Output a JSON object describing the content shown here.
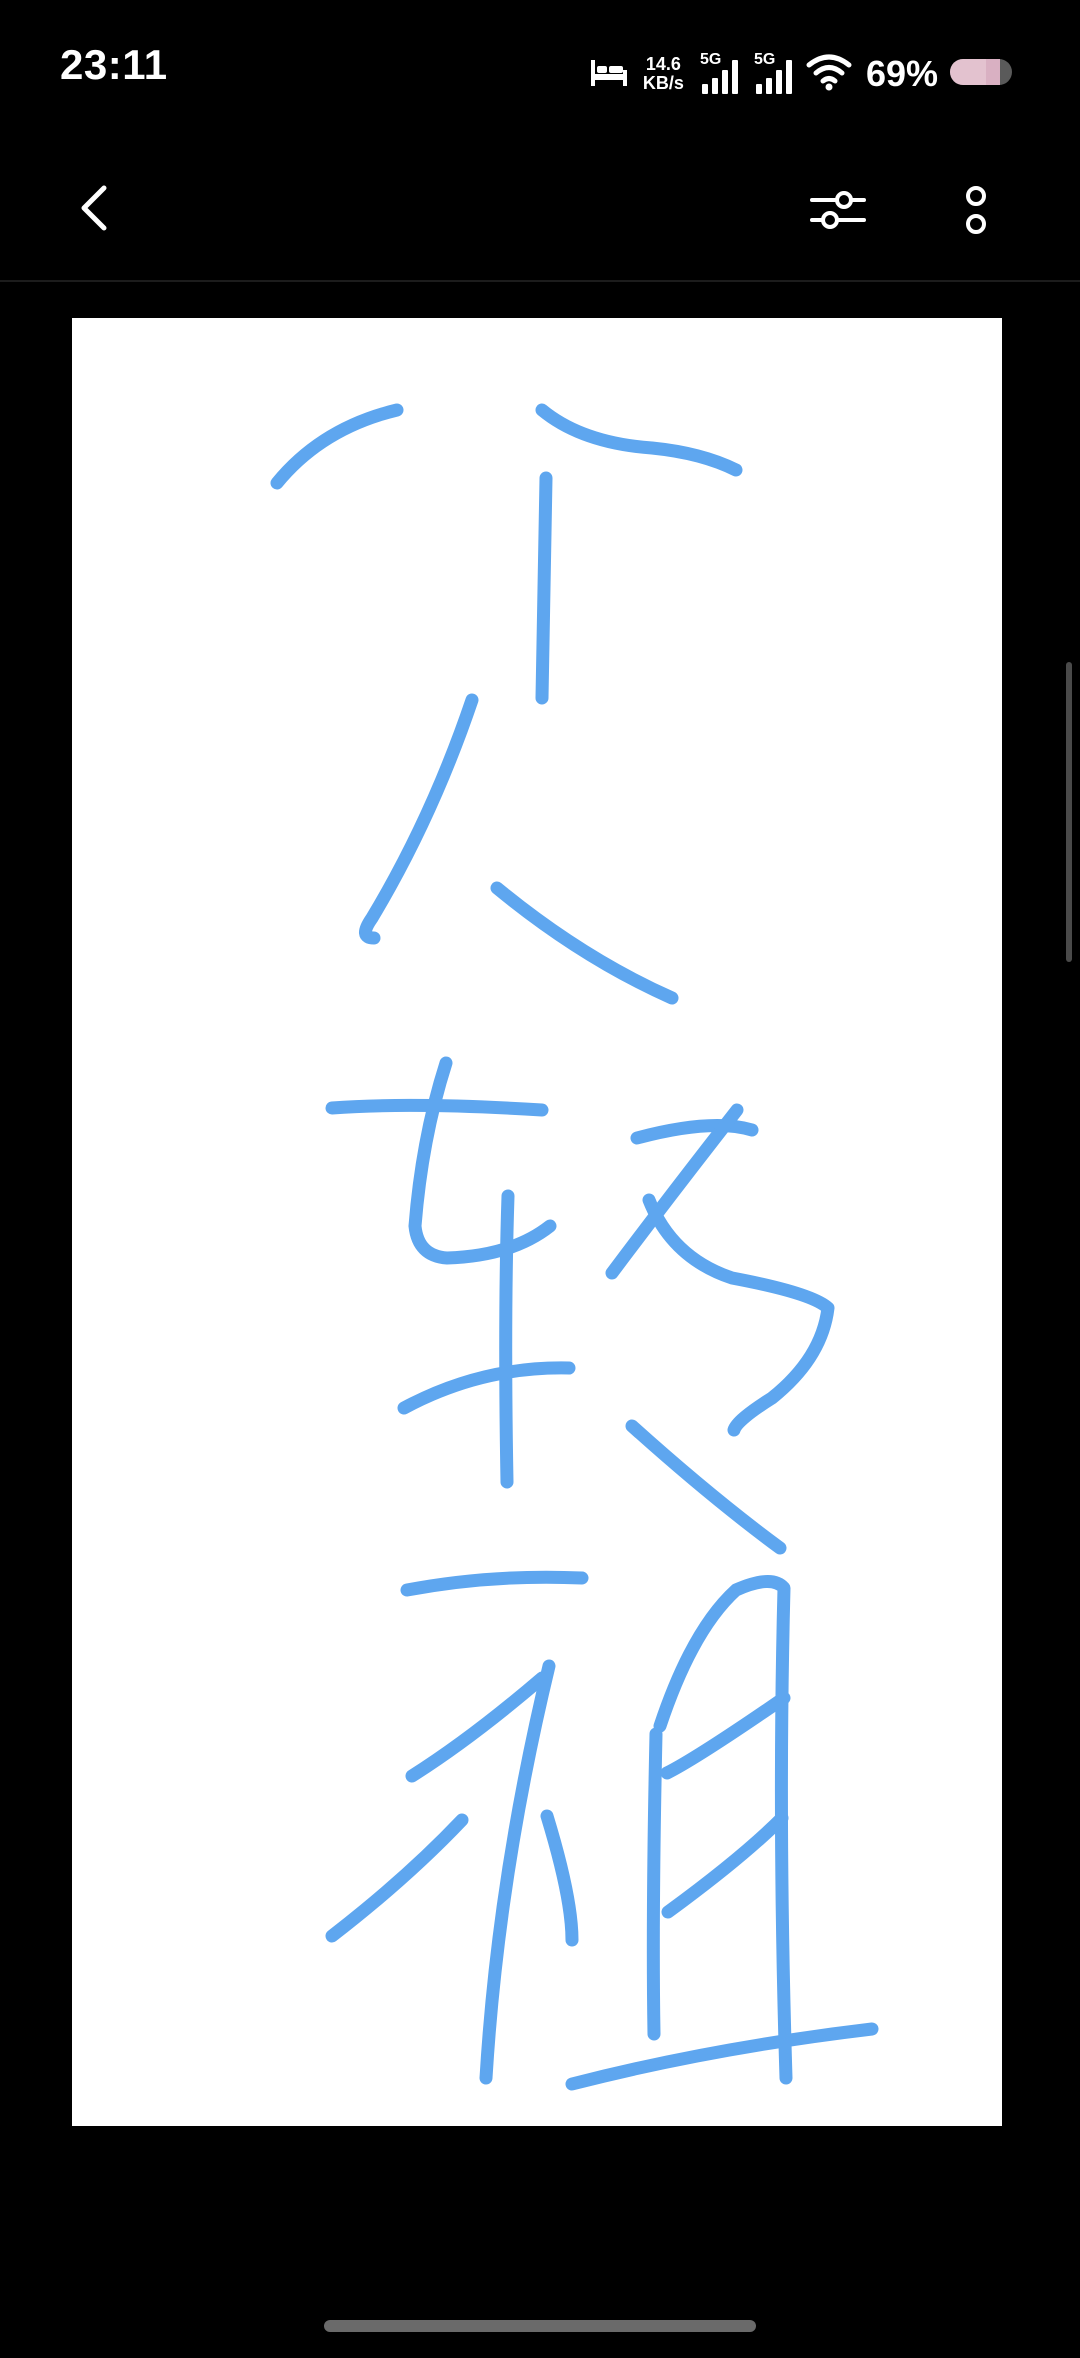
{
  "status_bar": {
    "time": "23:11",
    "net_speed_value": "14.6",
    "net_speed_unit": "KB/s",
    "sim1_tag": "5G",
    "sim2_tag": "5G",
    "battery_percent": "69%",
    "icons": [
      "bed-icon",
      "signal-icon",
      "signal-icon",
      "wifi-icon",
      "battery-icon"
    ]
  },
  "app_bar": {
    "icons": [
      "back-arrow-icon",
      "sliders-icon",
      "more-vertical-icon"
    ]
  },
  "drawing": {
    "background_color": "#ffffff",
    "stroke_color": "#5ea6ef"
  },
  "colors": {
    "background": "#000000",
    "text": "#ffffff"
  }
}
